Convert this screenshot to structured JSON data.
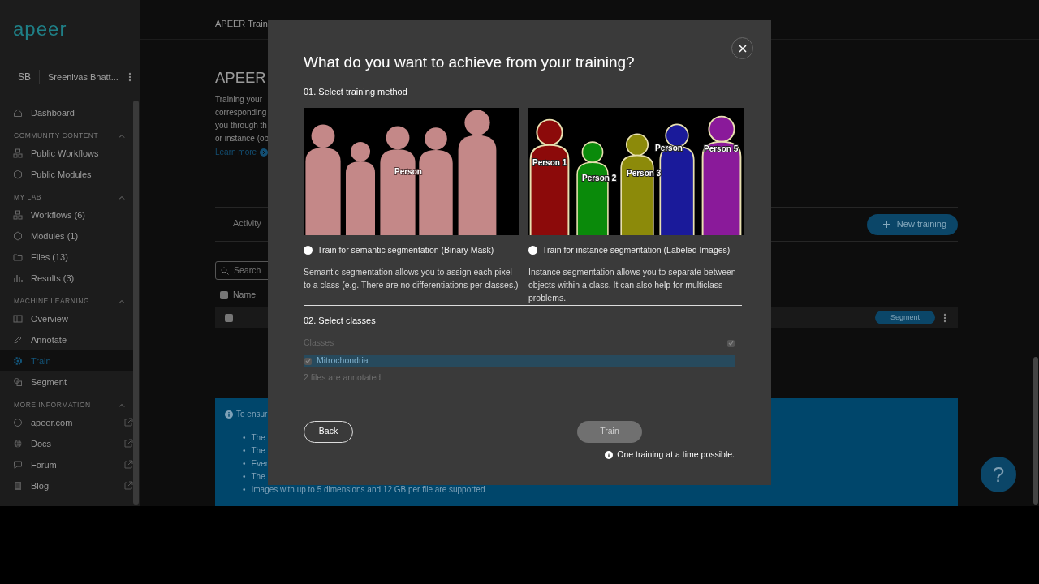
{
  "sidebar": {
    "logo": "apeer",
    "user": {
      "initials": "SB",
      "name": "Sreenivas Bhatt..."
    },
    "sections": [
      {
        "items": [
          {
            "label": "Dashboard",
            "selected": false,
            "external": false
          }
        ]
      },
      {
        "heading": "COMMUNITY CONTENT",
        "expanded": true,
        "items": [
          {
            "label": "Public Workflows",
            "selected": false,
            "external": false
          },
          {
            "label": "Public Modules",
            "selected": false,
            "external": false
          }
        ]
      },
      {
        "heading": "MY LAB",
        "expanded": true,
        "items": [
          {
            "label": "Workflows (6)",
            "selected": false,
            "external": false
          },
          {
            "label": "Modules (1)",
            "selected": false,
            "external": false
          },
          {
            "label": "Files (13)",
            "selected": false,
            "external": false
          },
          {
            "label": "Results (3)",
            "selected": false,
            "external": false
          }
        ]
      },
      {
        "heading": "MACHINE LEARNING",
        "expanded": true,
        "items": [
          {
            "label": "Overview",
            "selected": false,
            "external": false
          },
          {
            "label": "Annotate",
            "selected": false,
            "external": false
          },
          {
            "label": "Train",
            "selected": true,
            "external": false
          },
          {
            "label": "Segment",
            "selected": false,
            "external": false
          }
        ]
      },
      {
        "heading": "MORE INFORMATION",
        "expanded": true,
        "items": [
          {
            "label": "apeer.com",
            "selected": false,
            "external": true
          },
          {
            "label": "Docs",
            "selected": false,
            "external": true
          },
          {
            "label": "Forum",
            "selected": false,
            "external": true
          },
          {
            "label": "Blog",
            "selected": false,
            "external": true
          }
        ]
      }
    ]
  },
  "header_title": "APEER Train",
  "page": {
    "heading": "APEER",
    "intro": "Training   your\ncorresponding\nyou through th\nor instance (ob",
    "learn_more": "Learn more"
  },
  "tabs": [
    {
      "label": "Activity",
      "selected": false
    }
  ],
  "new_training_button": "New training",
  "search": {
    "placeholder": "Search"
  },
  "table": {
    "columns": [
      "Name"
    ],
    "all_checked": false,
    "rows": [
      {
        "checked": false,
        "action": "Segment"
      }
    ]
  },
  "info_box": {
    "lead": "To ensur",
    "bullet": "•",
    "items": [
      "The",
      "The",
      "Ever",
      "The",
      "Images with up to 5 dimensions and 12 GB per file are supported"
    ]
  },
  "help_button": "?",
  "modal": {
    "title": "What do you want to achieve from your training?",
    "step1": "01. Select training method",
    "methods": [
      {
        "kind": "semantic",
        "label": "Train for semantic segmentation (Binary Mask)",
        "description": "Semantic segmentation allows you to assign each pixel to a class (e.g. There are no differentiations per classes.)",
        "selected": false,
        "image_labels": [
          {
            "text": "Person",
            "color": "#c48888"
          }
        ]
      },
      {
        "kind": "instance",
        "label": "Train for instance segmentation (Labeled Images)",
        "description": "Instance segmentation allows you to separate between objects within a class. It can also help for multiclass problems.",
        "selected": false,
        "image_labels": [
          {
            "text": "Person 1",
            "color": "#8c0a0a"
          },
          {
            "text": "Person 2",
            "color": "#0a8a0a"
          },
          {
            "text": "Person 3",
            "color": "#8c8a0a"
          },
          {
            "text": "Person",
            "color": "#1a1a9a"
          },
          {
            "text": "Person 5",
            "color": "#8a1a9a"
          }
        ]
      }
    ],
    "step2": "02. Select classes",
    "classes": {
      "header": "Classes",
      "all_checked": true,
      "items": [
        {
          "label": "Mitrochondria",
          "checked": true,
          "selected": true
        }
      ]
    },
    "annotated_note": "2 files are annotated",
    "back": "Back",
    "train": {
      "label": "Train",
      "disabled": true
    },
    "note": "One training at a time possible."
  }
}
